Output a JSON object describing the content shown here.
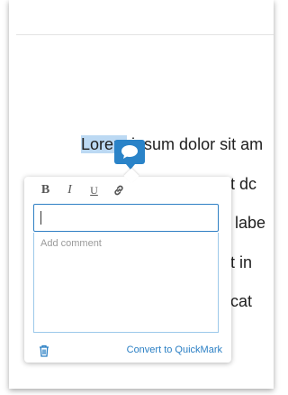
{
  "document": {
    "lines": [
      {
        "highlighted": "Lorem",
        "rest": " ipsum dolor sit am"
      },
      {
        "text": "et dc"
      },
      {
        "text": "e labe"
      },
      {
        "text": "rit in"
      },
      {
        "text": "ecat"
      }
    ]
  },
  "toolbar": {
    "bold_label": "B",
    "italic_label": "I",
    "underline_label": "U",
    "link_icon": "link-icon"
  },
  "comment": {
    "placeholder": "Add comment",
    "input_value": ""
  },
  "footer": {
    "convert_label": "Convert to QuickMark",
    "delete_icon": "trash-icon"
  },
  "colors": {
    "accent": "#2a83c8",
    "highlight": "#bcd9f3"
  }
}
